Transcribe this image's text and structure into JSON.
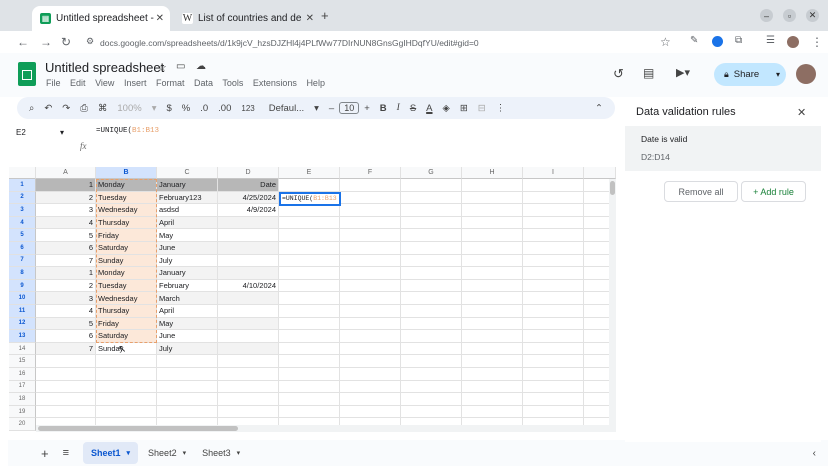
{
  "browser": {
    "tabs": [
      {
        "title": "Untitled spreadsheet - ",
        "active": true,
        "favicon": "sheets-icon"
      },
      {
        "title": "List of countries and de",
        "active": false,
        "favicon": "wikipedia-icon"
      }
    ],
    "url": "docs.google.com/spreadsheets/d/1k9jcV_hzsDJZHl4j4PLfWw77DIrNUN8GnsGgIHDqfYU/edit#gid=0"
  },
  "app": {
    "title": "Untitled spreadsheet",
    "menu": [
      "File",
      "Edit",
      "View",
      "Insert",
      "Format",
      "Data",
      "Tools",
      "Extensions",
      "Help"
    ],
    "share_label": "Share"
  },
  "toolbar": {
    "zoom": "100%",
    "currency": "$",
    "percent": "%",
    "dec_decrease": ".0",
    "dec_increase": ".00",
    "number_format": "123",
    "font": "Defaul...",
    "font_size": "10",
    "bold": "B",
    "italic": "I",
    "strike": "S",
    "text_color": "A"
  },
  "formula_bar": {
    "cell_ref": "E2",
    "formula_prefix": "=UNIQUE(",
    "formula_range": "B1:B13"
  },
  "grid": {
    "columns": [
      "A",
      "B",
      "C",
      "D",
      "E",
      "F",
      "G",
      "H",
      "I"
    ],
    "rows": [
      {
        "n": "1",
        "a": "1",
        "b": "Monday",
        "c": "January",
        "d": "Date"
      },
      {
        "n": "2",
        "a": "2",
        "b": "Tuesday",
        "c": "February123",
        "d": "4/25/2024"
      },
      {
        "n": "3",
        "a": "3",
        "b": "Wednesday",
        "c": "asdsd",
        "d": "4/9/2024"
      },
      {
        "n": "4",
        "a": "4",
        "b": "Thursday",
        "c": "April",
        "d": ""
      },
      {
        "n": "5",
        "a": "5",
        "b": "Friday",
        "c": "May",
        "d": ""
      },
      {
        "n": "6",
        "a": "6",
        "b": "Saturday",
        "c": "June",
        "d": ""
      },
      {
        "n": "7",
        "a": "7",
        "b": "Sunday",
        "c": "July",
        "d": ""
      },
      {
        "n": "8",
        "a": "1",
        "b": "Monday",
        "c": "January",
        "d": ""
      },
      {
        "n": "9",
        "a": "2",
        "b": "Tuesday",
        "c": "February",
        "d": "4/10/2024"
      },
      {
        "n": "10",
        "a": "3",
        "b": "Wednesday",
        "c": "March",
        "d": ""
      },
      {
        "n": "11",
        "a": "4",
        "b": "Thursday",
        "c": "April",
        "d": ""
      },
      {
        "n": "12",
        "a": "5",
        "b": "Friday",
        "c": "May",
        "d": ""
      },
      {
        "n": "13",
        "a": "6",
        "b": "Saturday",
        "c": "June",
        "d": ""
      },
      {
        "n": "14",
        "a": "7",
        "b": "Sunday",
        "c": "July",
        "d": ""
      },
      {
        "n": "15",
        "a": "",
        "b": "",
        "c": "",
        "d": ""
      },
      {
        "n": "16",
        "a": "",
        "b": "",
        "c": "",
        "d": ""
      },
      {
        "n": "17",
        "a": "",
        "b": "",
        "c": "",
        "d": ""
      },
      {
        "n": "18",
        "a": "",
        "b": "",
        "c": "",
        "d": ""
      },
      {
        "n": "19",
        "a": "",
        "b": "",
        "c": "",
        "d": ""
      },
      {
        "n": "20",
        "a": "",
        "b": "",
        "c": "",
        "d": ""
      }
    ],
    "active_cell_text_prefix": "=UNIQUE(",
    "active_cell_text_range": "B1:B13"
  },
  "sheets": [
    "Sheet1",
    "Sheet2",
    "Sheet3"
  ],
  "side_panel": {
    "title": "Data validation rules",
    "rule_title": "Date is valid",
    "rule_range": "D2:D14",
    "remove_all": "Remove all",
    "add_rule": "+ Add rule"
  },
  "colors": {
    "accent": "#0b57d0",
    "selection_fill": "#fce8d9",
    "header_gray": "#b7b7b7",
    "sheets_green": "#0f9d58"
  }
}
